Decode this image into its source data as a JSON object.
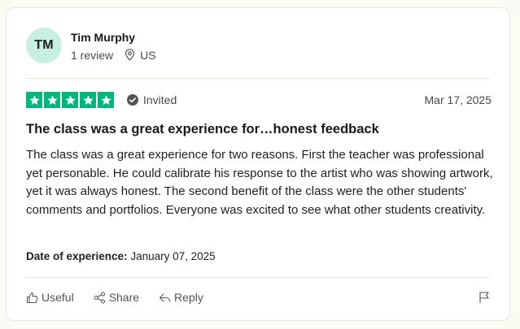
{
  "reviewer": {
    "initials": "TM",
    "name": "Tim Murphy",
    "review_count": "1 review",
    "country": "US",
    "avatar_color": "#c7f0e0"
  },
  "rating": {
    "stars": 5,
    "max_stars": 5,
    "star_color": "#00b67a",
    "badge": "Invited",
    "date": "Mar 17, 2025"
  },
  "review": {
    "title": "The class was a great experience for…honest feedback",
    "body": "The class was a great experience for two reasons. First the teacher was professional yet personable. He could calibrate his response to the artist who was showing artwork, yet it was always honest. The second benefit of the class were the other students' comments and portfolios. Everyone was excited to see what other students creativity.",
    "experience_label": "Date of experience:",
    "experience_date": "January 07, 2025"
  },
  "actions": {
    "useful": "Useful",
    "share": "Share",
    "reply": "Reply",
    "icons": [
      "thumbs-up-icon",
      "share-icon",
      "reply-icon",
      "flag-icon"
    ]
  }
}
